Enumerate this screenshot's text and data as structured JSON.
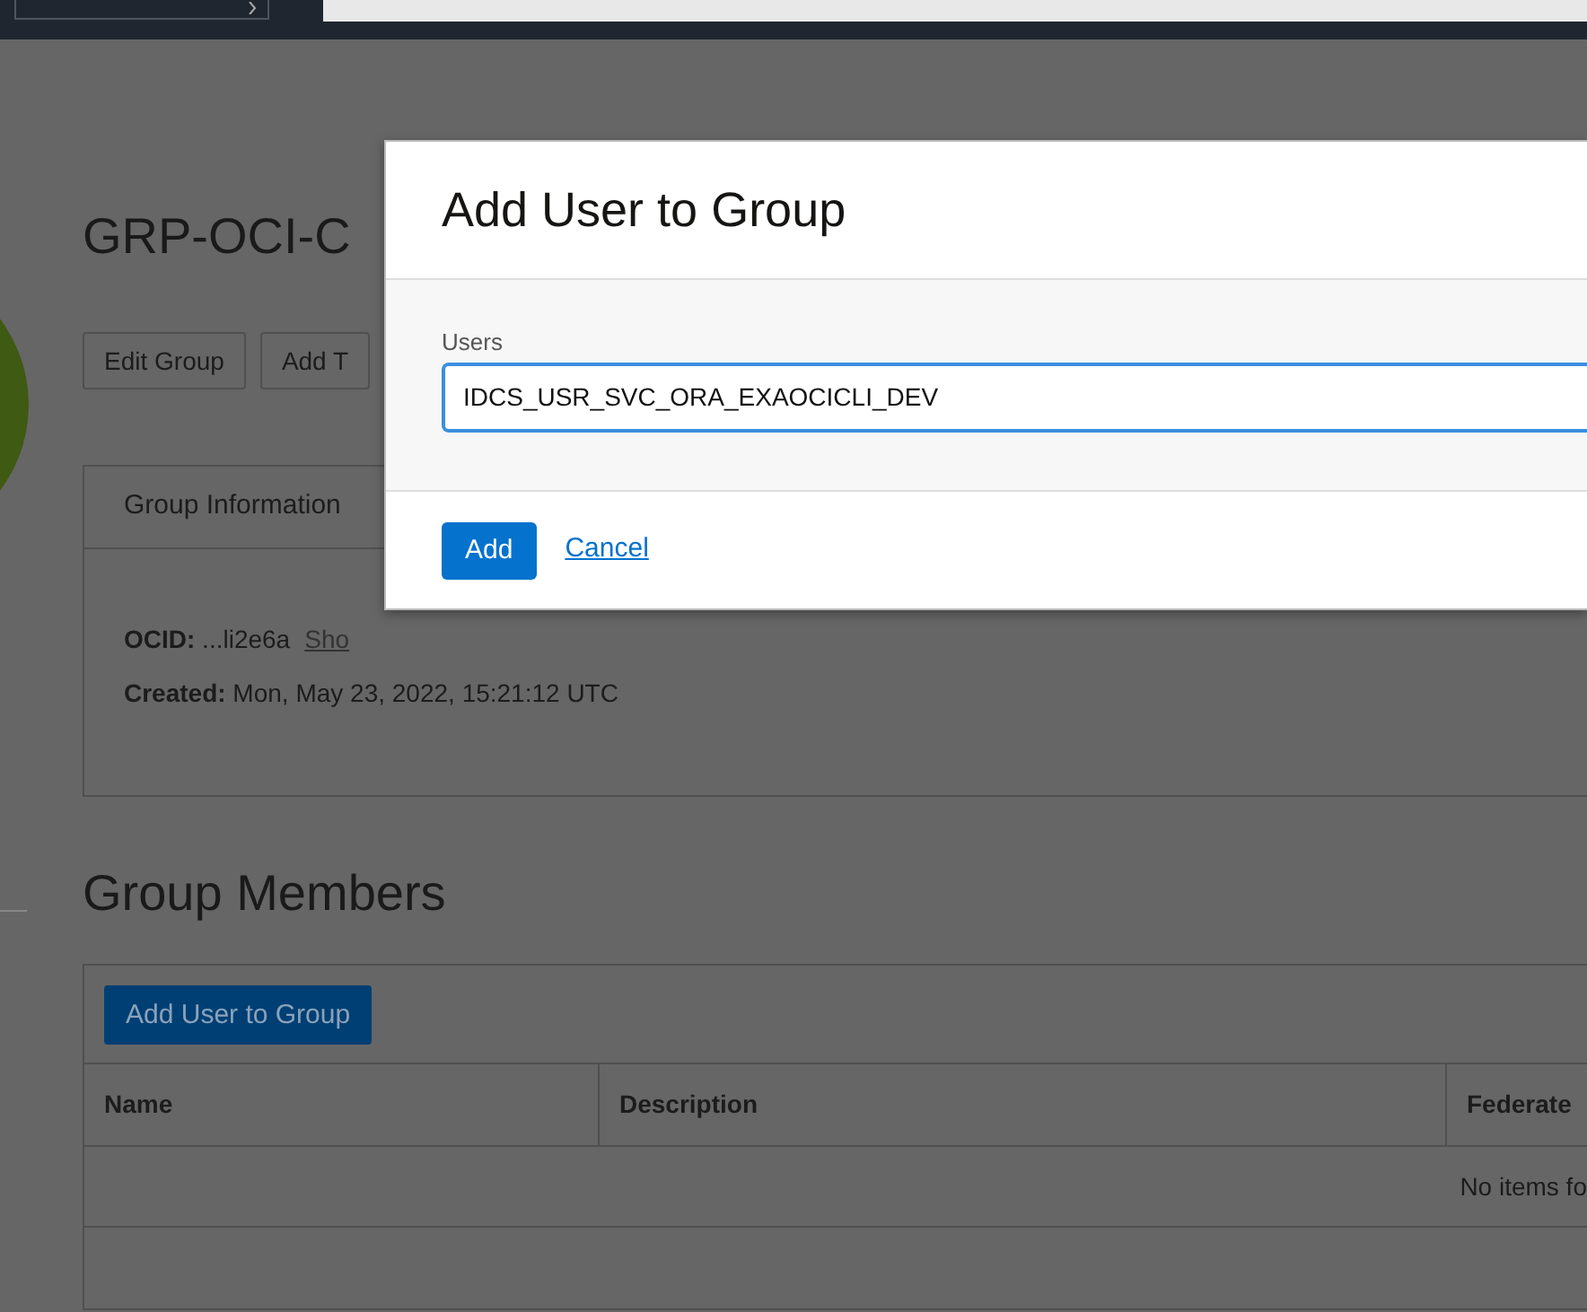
{
  "page": {
    "title": "GRP-OCI-C",
    "actions": [
      "Edit Group",
      "Add T"
    ],
    "info_tab": "Group Information",
    "ocid": {
      "text": "**OCID:** ...li2e6a",
      "link": "Sho"
    },
    "created": "**Created:** Mon, May 23, 2022, 15:21:12 UTC"
  },
  "members": {
    "title": "Group Members",
    "add_button": "Add User to Group",
    "columns": [
      "Name",
      "Description",
      "Federate"
    ],
    "empty_text": "No items fo"
  },
  "dialog": {
    "title": "Add User to Group",
    "field": {
      "label": "Users",
      "value": "IDCS_USR_SVC_ORA_EXAOCICLI_DEV",
      "focused": true
    },
    "buttons": [
      {
        "label": "Add",
        "kind": "primary"
      },
      {
        "label": "Cancel",
        "kind": "link"
      }
    ]
  }
}
